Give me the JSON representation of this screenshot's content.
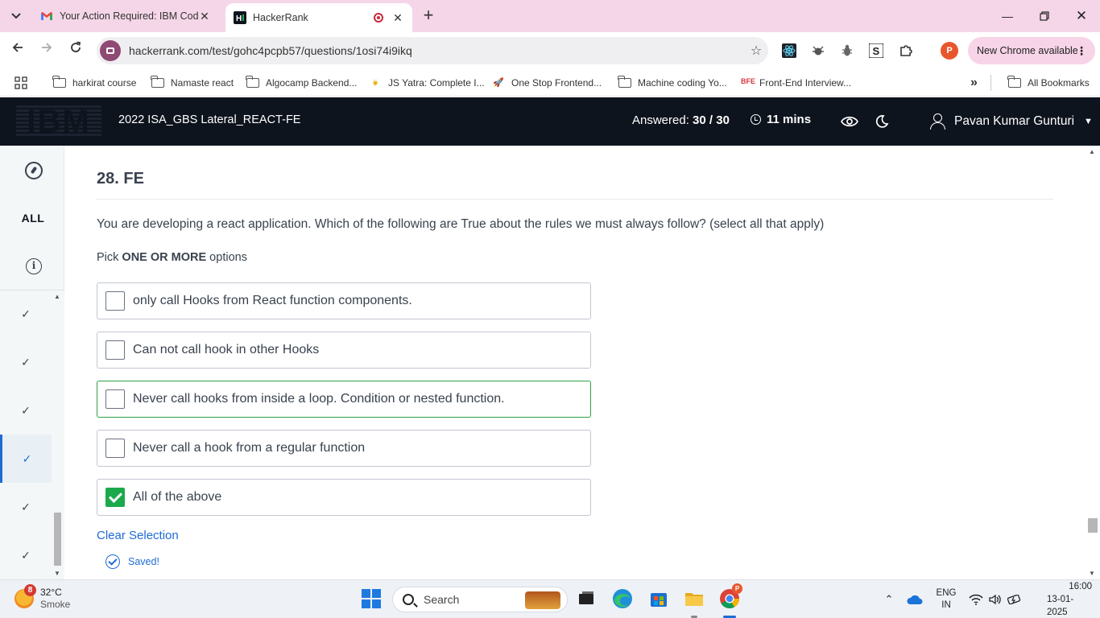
{
  "browser": {
    "tabs": [
      {
        "title": "Your Action Required: IBM Cod",
        "active": false,
        "favicon": "gmail-icon"
      },
      {
        "title": "HackerRank",
        "active": true,
        "favicon": "hackerrank-icon"
      }
    ],
    "url": "hackerrank.com/test/gohc4pcpb57/questions/1osi74i9ikq",
    "profile_initial": "P",
    "update_label": "New Chrome available",
    "bookmarks": [
      {
        "label": "harkirat course",
        "icon": "folder-icon"
      },
      {
        "label": "Namaste react",
        "icon": "folder-icon"
      },
      {
        "label": "Algocamp Backend...",
        "icon": "folder-icon"
      },
      {
        "label": "JS Yatra: Complete I...",
        "icon": "js-icon"
      },
      {
        "label": "One Stop Frontend...",
        "icon": "rocket-icon"
      },
      {
        "label": "Machine coding Yo...",
        "icon": "folder-icon"
      },
      {
        "label": "Front-End Interview...",
        "icon": "bfe-icon",
        "icon_text": "BFE"
      }
    ],
    "all_bookmarks_label": "All Bookmarks",
    "more_label": "»"
  },
  "header": {
    "logo": "IBM",
    "test_name": "2022 ISA_GBS Lateral_REACT-FE",
    "answered_label": "Answered:",
    "answered_value": "30 / 30",
    "time_left": "11 mins",
    "user_name": "Pavan Kumar Gunturi"
  },
  "sidebar": {
    "all_label": "ALL",
    "question_items": [
      {
        "status": "answered",
        "current": false,
        "mark": "✓"
      },
      {
        "status": "answered",
        "current": false,
        "mark": "✓"
      },
      {
        "status": "answered",
        "current": false,
        "mark": "✓"
      },
      {
        "status": "answered",
        "current": true,
        "mark": "✓"
      },
      {
        "status": "answered",
        "current": false,
        "mark": "✓"
      },
      {
        "status": "answered",
        "current": false,
        "mark": "✓"
      }
    ]
  },
  "question": {
    "title": "28. FE",
    "text": "You are developing a react application. Which of the following are True about the rules we must always follow? (select all that apply)",
    "pick_prefix": "Pick ",
    "pick_emphasis": "ONE OR MORE",
    "pick_suffix": " options",
    "options": [
      {
        "label": "only call Hooks from React function components.",
        "checked": false
      },
      {
        "label": "Can not call hook in other Hooks",
        "checked": false
      },
      {
        "label": "Never call hooks from inside a loop. Condition or nested function.",
        "checked": false,
        "highlighted": true
      },
      {
        "label": "Never call a hook from a regular function",
        "checked": false
      },
      {
        "label": "All of the above",
        "checked": true
      }
    ],
    "clear_label": "Clear Selection",
    "saved_label": "Saved!"
  },
  "taskbar": {
    "weather_temp": "32°C",
    "weather_condition": "Smoke",
    "weather_badge": "8",
    "search_placeholder": "Search",
    "lang_line1": "ENG",
    "lang_line2": "IN",
    "time": "16:00",
    "date": "13-01-2025",
    "chrome_badge": "P"
  },
  "colors": {
    "header_bg": "#0e141e",
    "checkbox_checked": "#1ba94c",
    "link": "#1f6bd6",
    "tab_strip": "#f5d6e8"
  }
}
